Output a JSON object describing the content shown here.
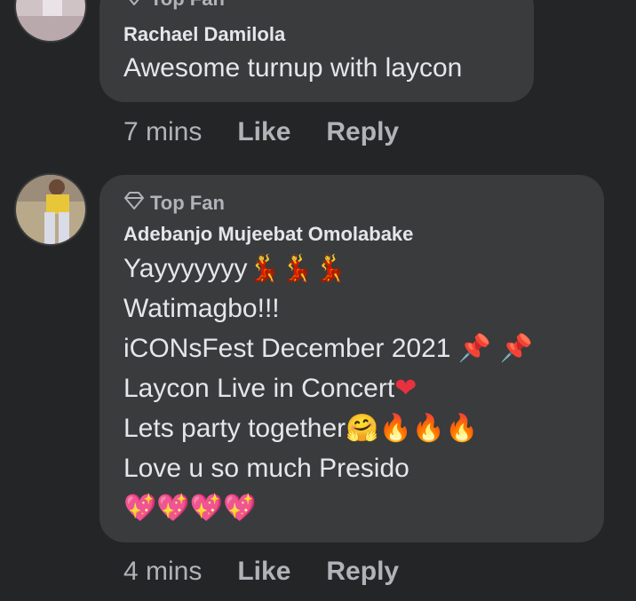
{
  "comments": [
    {
      "badge": "Top Fan",
      "author": "Rachael Damilola",
      "lines": [
        "Awesome turnup with laycon"
      ],
      "time": "7 mins",
      "like": "Like",
      "reply": "Reply"
    },
    {
      "badge": "Top Fan",
      "author": "Adebanjo Mujeebat Omolabake",
      "lines": [
        "Yayyyyyyy",
        "Watimagbo!!!",
        "iCONsFest December 2021",
        "Laycon Live in Concert",
        "Lets party together",
        "Love u so much Presido"
      ],
      "emoji": {
        "line1": "💃💃💃",
        "line3": "📌 📌",
        "line4": "❤",
        "line5": "🤗🔥🔥🔥",
        "line7": "💖💖💖💖"
      },
      "time": "4 mins",
      "like": "Like",
      "reply": "Reply"
    }
  ],
  "icons": {
    "badge_icon": "diamond-icon"
  },
  "colors": {
    "background": "#242526",
    "bubble": "#3a3b3c",
    "text": "#e4e6eb",
    "secondary": "#b0b3b8"
  }
}
